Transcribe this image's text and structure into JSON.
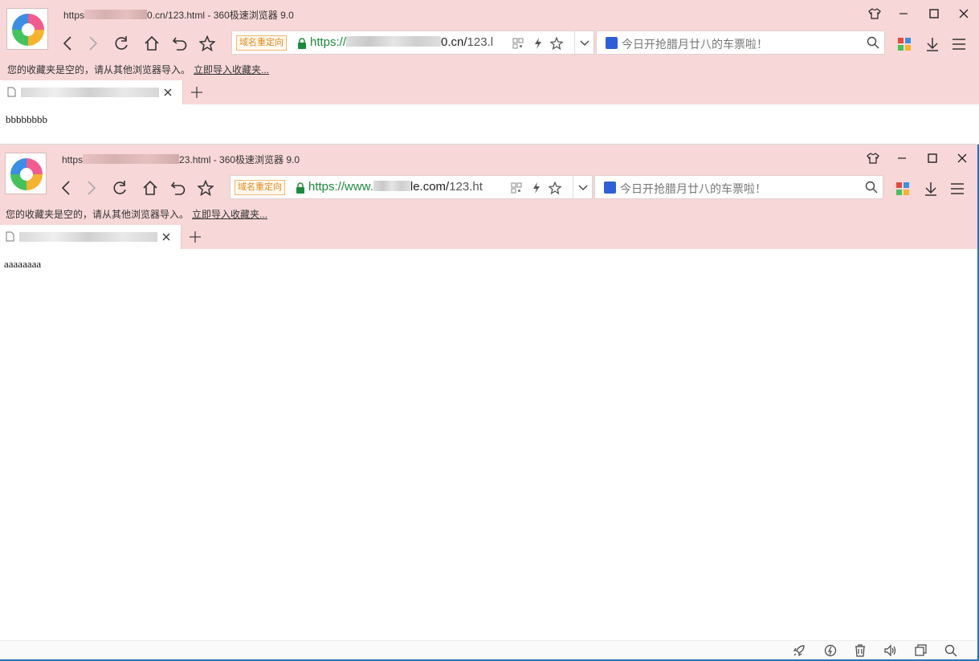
{
  "windows": [
    {
      "title_prefix": "https",
      "title_suffix": "0.cn/123.html - 360极速浏览器 9.0",
      "redirect_badge": "域名重定向",
      "url_scheme": "https://",
      "url_host_end": "0.cn/",
      "url_path": "123.l",
      "search_text": "今日开抢腊月廿八的车票啦！",
      "favbar_text": "您的收藏夹是空的，请从其他浏览器导入。",
      "favbar_link": "立即导入收藏夹...",
      "page_text": "bbbbbbbb"
    },
    {
      "title_prefix": "https",
      "title_suffix": "23.html - 360极速浏览器 9.0",
      "redirect_badge": "域名重定向",
      "url_scheme": "https://www.",
      "url_host_end": "le.com/",
      "url_path": "123.ht",
      "search_text": "今日开抢腊月廿八的车票啦！",
      "favbar_text": "您的收藏夹是空的，请从其他浏览器导入。",
      "favbar_link": "立即导入收藏夹...",
      "page_text": "aaaaaaaa"
    }
  ],
  "icons": {
    "logo": "360-browser-logo-icon",
    "back": "back-icon",
    "forward": "forward-icon",
    "reload": "reload-icon",
    "home": "home-icon",
    "undo": "undo-close-icon",
    "bookmark": "star-icon",
    "qr": "qr-code-icon",
    "speed": "lightning-icon",
    "address_star": "star-icon",
    "dropdown": "chevron-down-icon",
    "search": "search-icon",
    "apps": "apps-grid-icon",
    "download": "download-icon",
    "menu": "menu-icon",
    "skin": "skin-shirt-icon",
    "minimize": "minimize-icon",
    "maximize": "maximize-icon",
    "close": "close-icon",
    "status": [
      "rocket-icon",
      "acceleration-icon",
      "trash-icon",
      "sound-icon",
      "window-icon",
      "search-icon"
    ]
  },
  "colors": {
    "chrome": "#f7d7d7",
    "url_green": "#1a8b3b",
    "badge_orange": "#e08a1c",
    "frame_blue": "#2c6fb5"
  }
}
